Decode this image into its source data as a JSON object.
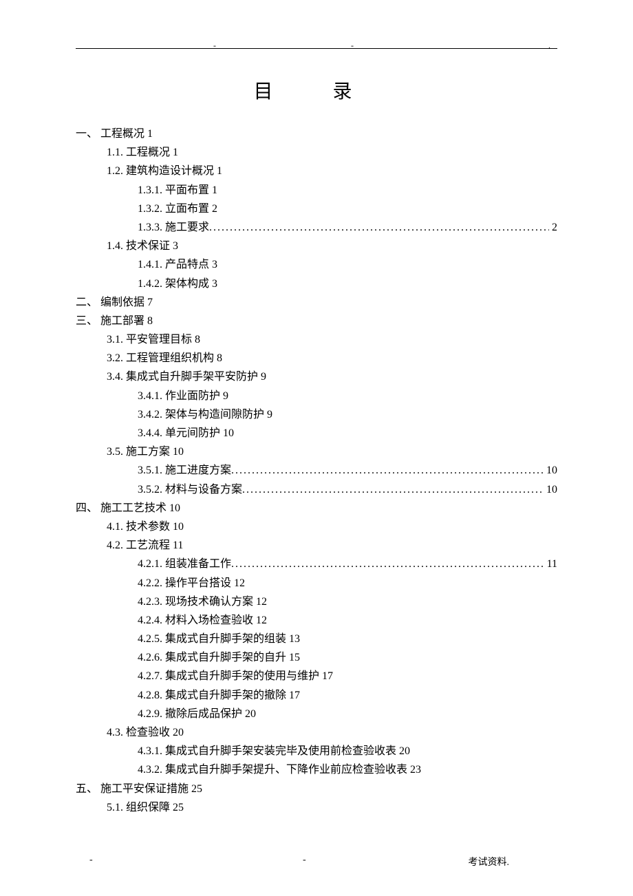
{
  "title": "目 录",
  "footer_text": "考试资料.",
  "toc": [
    {
      "level": 0,
      "num": "一、",
      "text": "工程概况",
      "page": "1",
      "dotted": false
    },
    {
      "level": 1,
      "num": "1.1.",
      "text": "工程概况",
      "page": "1",
      "dotted": false
    },
    {
      "level": 1,
      "num": "1.2.",
      "text": "建筑构造设计概况",
      "page": "1",
      "dotted": false
    },
    {
      "level": 2,
      "num": "1.3.1.",
      "text": "平面布置",
      "page": "1",
      "dotted": false
    },
    {
      "level": 2,
      "num": "1.3.2.",
      "text": "立面布置",
      "page": "2",
      "dotted": false
    },
    {
      "level": 2,
      "num": "1.3.3.",
      "text": "施工要求",
      "page": "2",
      "dotted": true
    },
    {
      "level": 1,
      "num": "1.4.",
      "text": "技术保证",
      "page": "3",
      "dotted": false
    },
    {
      "level": 2,
      "num": "1.4.1.",
      "text": "产品特点",
      "page": "3",
      "dotted": false
    },
    {
      "level": 2,
      "num": "1.4.2.",
      "text": "架体构成",
      "page": "3",
      "dotted": false
    },
    {
      "level": 0,
      "num": "二、",
      "text": "编制依据",
      "page": "7",
      "dotted": false
    },
    {
      "level": 0,
      "num": "三、",
      "text": "施工部署",
      "page": "8",
      "dotted": false
    },
    {
      "level": 1,
      "num": "3.1.",
      "text": "平安管理目标",
      "page": "8",
      "dotted": false
    },
    {
      "level": 1,
      "num": "3.2.",
      "text": "工程管理组织机构",
      "page": "8",
      "dotted": false
    },
    {
      "level": 1,
      "num": "3.4.",
      "text": "集成式自升脚手架平安防护",
      "page": "9",
      "dotted": false
    },
    {
      "level": 2,
      "num": "3.4.1.",
      "text": "作业面防护",
      "page": "9",
      "dotted": false
    },
    {
      "level": 2,
      "num": "3.4.2.",
      "text": "架体与构造间隙防护",
      "page": "9",
      "dotted": false
    },
    {
      "level": 2,
      "num": "3.4.4.",
      "text": "单元间防护",
      "page": "10",
      "dotted": false
    },
    {
      "level": 1,
      "num": "3.5.",
      "text": "施工方案",
      "page": "10",
      "dotted": false
    },
    {
      "level": 2,
      "num": "3.5.1.",
      "text": "施工进度方案",
      "page": "10",
      "dotted": true
    },
    {
      "level": 2,
      "num": "3.5.2.",
      "text": "材料与设备方案",
      "page": "10",
      "dotted": true
    },
    {
      "level": 0,
      "num": "四、",
      "text": "施工工艺技术",
      "page": "10",
      "dotted": false
    },
    {
      "level": 1,
      "num": "4.1.",
      "text": "技术参数",
      "page": "10",
      "dotted": false
    },
    {
      "level": 1,
      "num": "4.2.",
      "text": "工艺流程",
      "page": "11",
      "dotted": false
    },
    {
      "level": 2,
      "num": "4.2.1.",
      "text": "组装准备工作",
      "page": "11",
      "dotted": true
    },
    {
      "level": 2,
      "num": "4.2.2.",
      "text": "操作平台搭设",
      "page": "12",
      "dotted": false
    },
    {
      "level": 2,
      "num": "4.2.3.",
      "text": "现场技术确认方案",
      "page": "12",
      "dotted": false
    },
    {
      "level": 2,
      "num": "4.2.4.",
      "text": "材料入场检查验收",
      "page": "12",
      "dotted": false
    },
    {
      "level": 2,
      "num": "4.2.5.",
      "text": "集成式自升脚手架的组装",
      "page": "13",
      "dotted": false
    },
    {
      "level": 2,
      "num": "4.2.6.",
      "text": "集成式自升脚手架的自升",
      "page": "15",
      "dotted": false
    },
    {
      "level": 2,
      "num": "4.2.7.",
      "text": "集成式自升脚手架的使用与维护",
      "page": "17",
      "dotted": false
    },
    {
      "level": 2,
      "num": "4.2.8.",
      "text": "集成式自升脚手架的撤除",
      "page": "17",
      "dotted": false
    },
    {
      "level": 2,
      "num": "4.2.9.",
      "text": "撤除后成品保护",
      "page": "20",
      "dotted": false
    },
    {
      "level": 1,
      "num": "4.3.",
      "text": "检查验收",
      "page": "20",
      "dotted": false
    },
    {
      "level": 2,
      "num": "4.3.1.",
      "text": "集成式自升脚手架安装完毕及使用前检查验收表",
      "page": "20",
      "dotted": false
    },
    {
      "level": 2,
      "num": "4.3.2.",
      "text": "集成式自升脚手架提升、下降作业前应检查验收表",
      "page": "23",
      "dotted": false
    },
    {
      "level": 0,
      "num": "五、",
      "text": "施工平安保证措施",
      "page": "25",
      "dotted": false
    },
    {
      "level": 1,
      "num": "5.1.",
      "text": "组织保障",
      "page": "25",
      "dotted": false
    }
  ]
}
